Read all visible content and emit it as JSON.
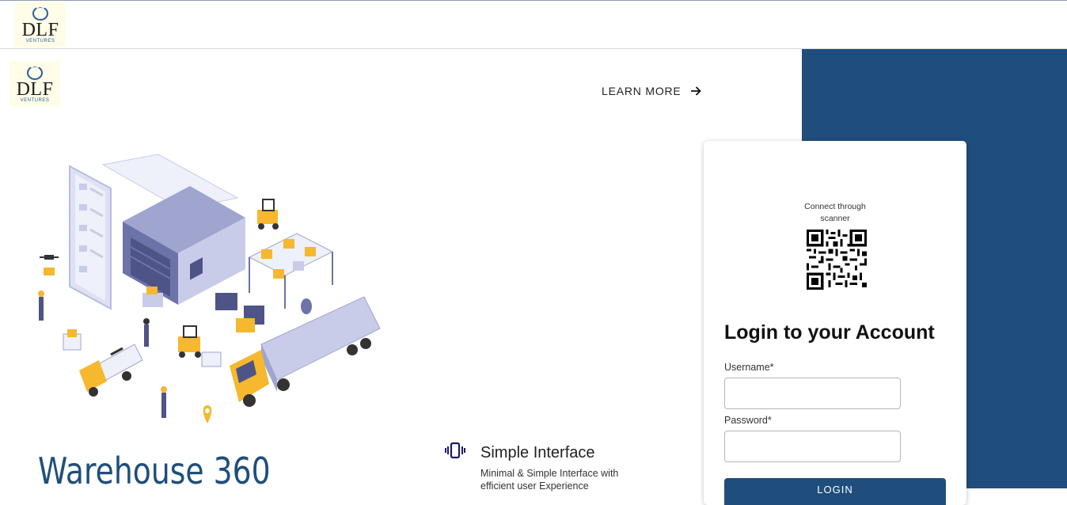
{
  "header": {
    "logo": {
      "mark": "DLF",
      "sub": "VENTURES"
    }
  },
  "hero": {
    "logo": {
      "mark": "DLF",
      "sub": "VENTURES"
    },
    "learn_more": "LEARN MORE",
    "brand_title": "Warehouse 360"
  },
  "feature": {
    "title": "Simple Interface",
    "desc_line1": "Minimal & Simple Interface with",
    "desc_line2": "efficient user Experience"
  },
  "login": {
    "connect_line1": "Connect through",
    "connect_line2": "scanner",
    "title": "Login to your Account",
    "username_label": "Username*",
    "username_value": "",
    "password_label": "Password*",
    "password_value": "",
    "button": "LOGIN"
  },
  "colors": {
    "brand": "#1f4e7c",
    "accent_yellow": "#f5b82e",
    "illustration_lavender": "#c9cce8"
  },
  "icons": [
    "arrow-right-icon",
    "vibrate-phone-icon",
    "qr-code-icon"
  ]
}
